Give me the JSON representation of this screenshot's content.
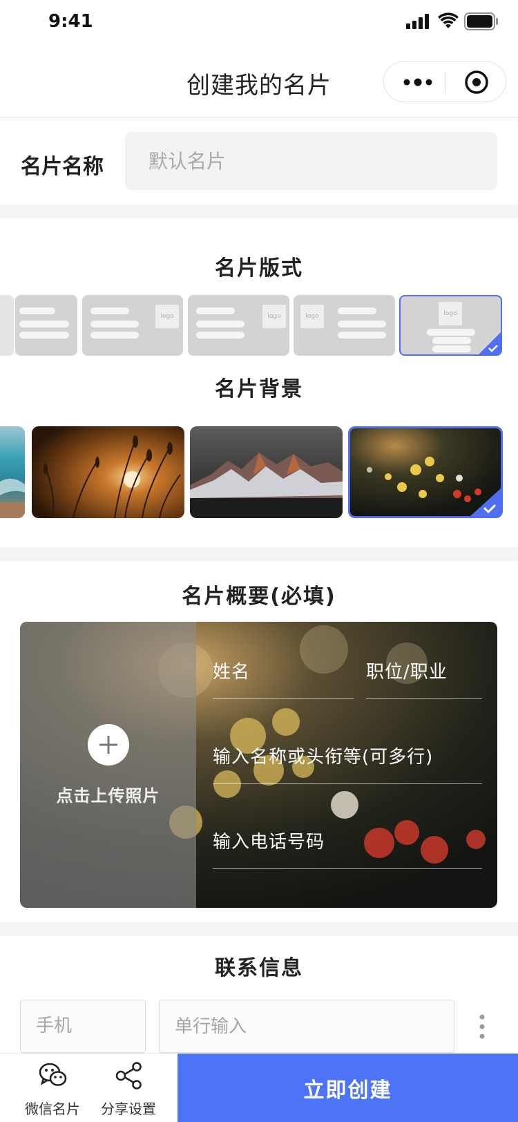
{
  "status_bar": {
    "time": "9:41"
  },
  "nav": {
    "title": "创建我的名片"
  },
  "card_name": {
    "label": "名片名称",
    "placeholder": "默认名片"
  },
  "layout_section": {
    "title": "名片版式",
    "logo_text": "logo",
    "selected_index": 5
  },
  "background_section": {
    "title": "名片背景",
    "selected_index": 4
  },
  "summary_section": {
    "title": "名片概要(必填)",
    "upload_label": "点击上传照片",
    "name_placeholder": "姓名",
    "position_placeholder": "职位/职业",
    "title_placeholder": "输入名称或头衔等(可多行)",
    "phone_placeholder": "输入电话号码"
  },
  "contact_section": {
    "title": "联系信息",
    "type_value": "手机",
    "input_placeholder": "单行输入"
  },
  "bottom_bar": {
    "wechat_card_label": "微信名片",
    "share_settings_label": "分享设置",
    "create_label": "立即创建"
  },
  "colors": {
    "accent": "#4d74f7",
    "selected_border": "#4f6ef2",
    "template_bg": "#d3d3d3",
    "separator": "#f4f4f4"
  },
  "icons": [
    "signal-icon",
    "wifi-icon",
    "battery-icon",
    "more-icon",
    "target-icon",
    "check-icon",
    "plus-icon",
    "kebab-icon",
    "wechat-icon",
    "share-icon"
  ]
}
